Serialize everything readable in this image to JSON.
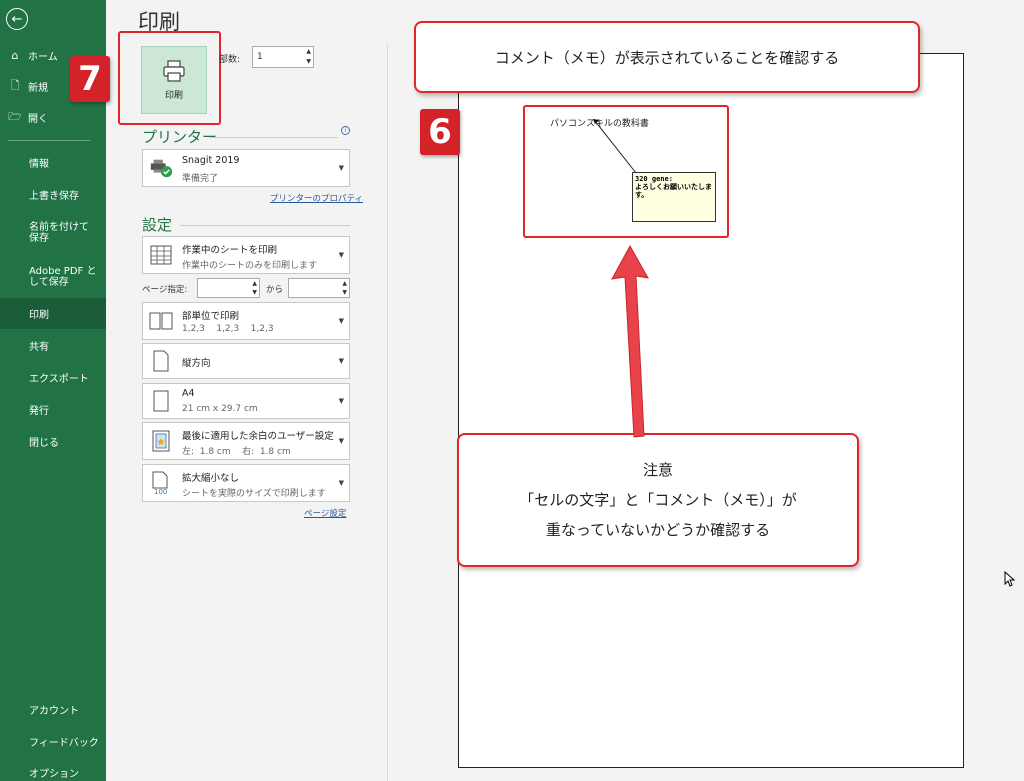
{
  "sidebar": {
    "back_glyph": "←",
    "items": [
      {
        "label": "ホーム",
        "icon": "home-icon"
      },
      {
        "label": "新規",
        "icon": "new-doc-icon"
      },
      {
        "label": "開く",
        "icon": "folder-icon"
      },
      {
        "label": "情報"
      },
      {
        "label": "上書き保存"
      },
      {
        "label": "名前を付けて保存"
      },
      {
        "label": "Adobe PDF として保存"
      },
      {
        "label": "印刷"
      },
      {
        "label": "共有"
      },
      {
        "label": "エクスポート"
      },
      {
        "label": "発行"
      },
      {
        "label": "閉じる"
      },
      {
        "label": "アカウント"
      },
      {
        "label": "フィードバック"
      },
      {
        "label": "オプション"
      }
    ]
  },
  "print": {
    "title": "印刷",
    "button_label": "印刷",
    "copies_label": "部数:",
    "copies_value": "1"
  },
  "printer": {
    "section_title": "プリンター",
    "name": "Snagit 2019",
    "status": "準備完了",
    "properties_link": "プリンターのプロパティ"
  },
  "settings": {
    "section_title": "設定",
    "scope": {
      "main": "作業中のシートを印刷",
      "sub": "作業中のシートのみを印刷します"
    },
    "pages_label": "ページ指定:",
    "pages_to": "から",
    "collate": {
      "main": "部単位で印刷",
      "sub": "1,2,3    1,2,3    1,2,3"
    },
    "orientation": {
      "main": "縦方向"
    },
    "paper": {
      "main": "A4",
      "sub": "21 cm x 29.7 cm"
    },
    "margins": {
      "main": "最後に適用した余白のユーザー設定",
      "sub": "左:  1.8 cm    右:  1.8 cm"
    },
    "scaling": {
      "main": "拡大縮小なし",
      "sub": "シートを実際のサイズで印刷します"
    },
    "page_setup_link": "ページ設定"
  },
  "preview": {
    "cell_text": "パソコンスキルの教科書",
    "comment_text": "320 gene:\nよろしくお願いいたします。"
  },
  "annotations": {
    "callout_top": "コメント（メモ）が表示されていることを確認する",
    "callout_bottom_title": "注意",
    "callout_bottom_line1": "「セルの文字」と「コメント（メモ）」が",
    "callout_bottom_line2": "重なっていないかどうか確認する",
    "badge_6": "6",
    "badge_7": "7"
  },
  "colors": {
    "sidebar": "#217346",
    "accent_red": "#e0262b",
    "print_button": "#cce8d4"
  }
}
